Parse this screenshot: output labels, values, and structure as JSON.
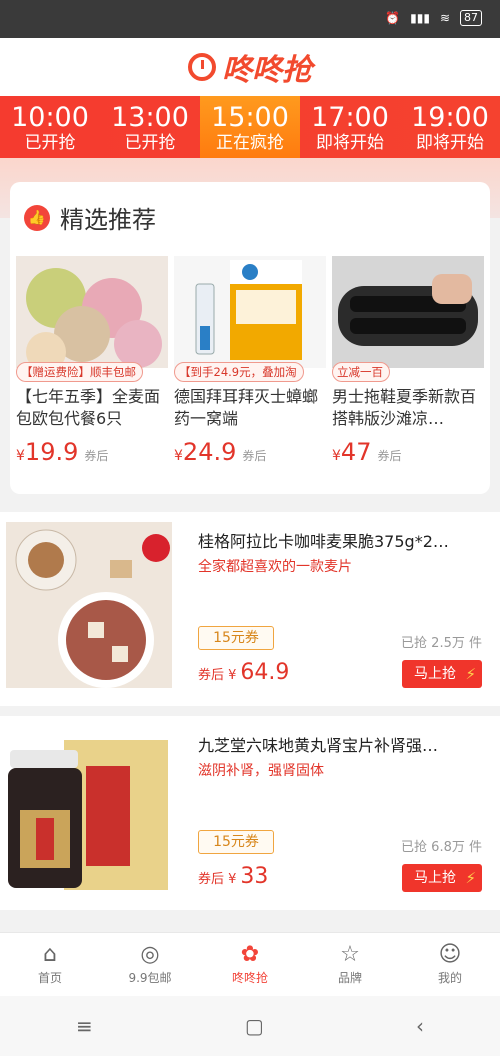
{
  "status": {
    "battery": "87"
  },
  "app": {
    "logo_text": "咚咚抢"
  },
  "time_slots": [
    {
      "time": "10:00",
      "state": "已开抢"
    },
    {
      "time": "13:00",
      "state": "已开抢"
    },
    {
      "time": "15:00",
      "state": "正在疯抢"
    },
    {
      "time": "17:00",
      "state": "即将开始"
    },
    {
      "time": "19:00",
      "state": "即将开始"
    }
  ],
  "featured": {
    "title": "精选推荐",
    "items": [
      {
        "tag": "【赠运费险】顺丰包邮",
        "name": "【七年五季】全麦面包欧包代餐6只",
        "price": "19.9",
        "price_symbol": "¥",
        "after": "券后"
      },
      {
        "tag": "【到手24.9元，叠加淘",
        "name": "德国拜耳拜灭士蟑螂药一窝端",
        "price": "24.9",
        "price_symbol": "¥",
        "after": "券后"
      },
      {
        "tag": "立减一百",
        "name": "男士拖鞋夏季新款百搭韩版沙滩凉…",
        "price": "47",
        "price_symbol": "¥",
        "after": "券后"
      }
    ]
  },
  "products": [
    {
      "name": "桂格阿拉比卡咖啡麦果脆375g*2…",
      "sub": "全家都超喜欢的一款麦片",
      "coupon": "15元券",
      "price_prefix": "券后 ¥",
      "price": "64.9",
      "sold": "已抢 2.5万 件",
      "buy": "马上抢"
    },
    {
      "name": "九芝堂六味地黄丸肾宝片补肾强…",
      "sub": "滋阴补肾，强肾固体",
      "coupon": "15元券",
      "price_prefix": "券后 ¥",
      "price": "33",
      "sold": "已抢 6.8万 件",
      "buy": "马上抢"
    }
  ],
  "tabs": [
    {
      "label": "首页",
      "icon": "home-icon"
    },
    {
      "label": "9.9包邮",
      "icon": "99-icon"
    },
    {
      "label": "咚咚抢",
      "icon": "flower-icon"
    },
    {
      "label": "品牌",
      "icon": "star-icon"
    },
    {
      "label": "我的",
      "icon": "user-icon"
    }
  ],
  "colors": {
    "accent": "#f2453a",
    "active_slot": "#ff8a16"
  }
}
